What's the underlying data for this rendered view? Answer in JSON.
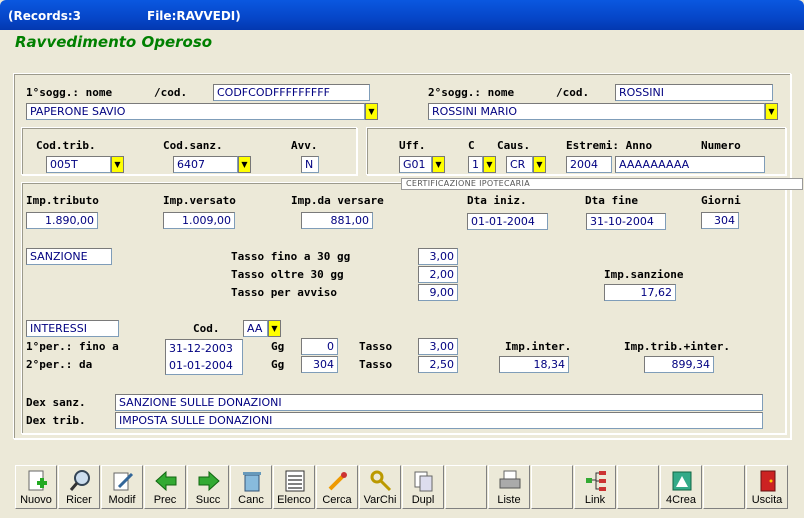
{
  "titlebar": {
    "records": "(Records:3",
    "file": "File:RAVVEDI)"
  },
  "heading": "Ravvedimento Operoso",
  "sogg1": {
    "lbl_nome": "1°sogg.: nome",
    "lbl_cod": "/cod.",
    "cod": "CODFCODFFFFFFFFF",
    "nome": "PAPERONE SAVIO"
  },
  "sogg2": {
    "lbl_nome": "2°sogg.: nome",
    "lbl_cod": "/cod.",
    "cod": "ROSSINI",
    "nome": "ROSSINI MARIO"
  },
  "trib": {
    "lbl_codtrib": "Cod.trib.",
    "codtrib": "005T",
    "lbl_codsanz": "Cod.sanz.",
    "codsanz": "6407",
    "lbl_avv": "Avv.",
    "avv": "N"
  },
  "uff": {
    "lbl_uff": "Uff.",
    "uff": "G01",
    "lbl_c": "C",
    "c": "1",
    "lbl_caus": "Caus.",
    "caus": "CR",
    "lbl_estremi": "Estremi: Anno",
    "anno": "2004",
    "lbl_numero": "Numero",
    "numero": "AAAAAAAAA",
    "tooltip": "CERTIFICAZIONE IPOTECARIA"
  },
  "imp": {
    "lbl_tributo": "Imp.tributo",
    "tributo": "1.890,00",
    "lbl_versato": "Imp.versato",
    "versato": "1.009,00",
    "lbl_daversare": "Imp.da versare",
    "daversare": "881,00",
    "lbl_dtaini": "Dta iniz.",
    "dtaini": "01-01-2004",
    "lbl_dtafine": "Dta fine",
    "dtafine": "31-10-2004",
    "lbl_giorni": "Giorni",
    "giorni": "304"
  },
  "sanz": {
    "label": "SANZIONE",
    "lbl_t30": "Tasso fino a 30 gg",
    "t30": "3,00",
    "lbl_tolt": "Tasso oltre 30 gg",
    "tolt": "2,00",
    "lbl_tavv": "Tasso per avviso",
    "tavv": "9,00",
    "lbl_impsanz": "Imp.sanzione",
    "impsanz": "17,62"
  },
  "int": {
    "label": "INTERESSI",
    "lbl_cod": "Cod.",
    "cod": "AA",
    "lbl_p1": "1°per.: fino a",
    "p1": "31-12-2003",
    "lbl_p2": "2°per.: da",
    "p2": "01-01-2004",
    "lbl_gg": "Gg",
    "gg1": "0",
    "gg2": "304",
    "lbl_tasso": "Tasso",
    "tasso1": "3,00",
    "tasso2": "2,50",
    "lbl_impint": "Imp.inter.",
    "impint": "18,34",
    "lbl_imptribint": "Imp.trib.+inter.",
    "imptribint": "899,34"
  },
  "dex": {
    "lbl_sanz": "Dex sanz.",
    "sanz": "SANZIONE SULLE DONAZIONI",
    "lbl_trib": "Dex trib.",
    "trib": "IMPOSTA SULLE DONAZIONI"
  },
  "toolbar": [
    "Nuovo",
    "Ricer",
    "Modif",
    "Prec",
    "Succ",
    "Canc",
    "Elenco",
    "Cerca",
    "VarChi",
    "Dupl",
    "Liste",
    "Link",
    "4Crea",
    "Uscita"
  ]
}
